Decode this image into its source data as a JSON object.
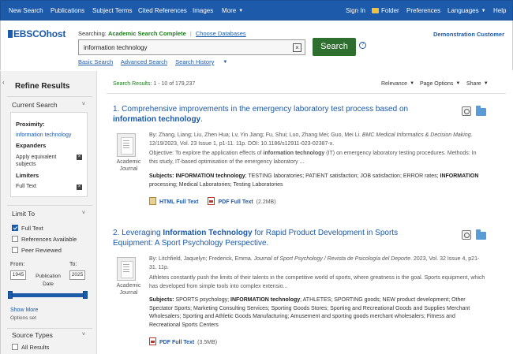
{
  "topnav": {
    "left": [
      "New Search",
      "Publications",
      "Subject Terms",
      "Cited References",
      "Images",
      "More"
    ],
    "right": {
      "signin": "Sign In",
      "folder": "Folder",
      "preferences": "Preferences",
      "languages": "Languages",
      "help": "Help"
    }
  },
  "header": {
    "logo": "EBSCOhost",
    "searching_label": "Searching:",
    "database": "Academic Search Complete",
    "choose_db": "Choose Databases",
    "query": "information technology",
    "search_button": "Search",
    "help_icon": "?",
    "links": [
      "Basic Search",
      "Advanced Search",
      "Search History"
    ],
    "customer": "Demonstration Customer"
  },
  "sidebar": {
    "title": "Refine Results",
    "current_search": "Current Search",
    "proximity_label": "Proximity:",
    "proximity_value": "information technology",
    "expanders_label": "Expanders",
    "expander_value": "Apply equivalent subjects",
    "limiters_label": "Limiters",
    "limiter_value": "Full Text",
    "limit_to": "Limit To",
    "checkboxes": [
      {
        "label": "Full Text",
        "checked": true
      },
      {
        "label": "References Available",
        "checked": false
      },
      {
        "label": "Peer Reviewed",
        "checked": false
      }
    ],
    "from_label": "From:",
    "to_label": "To:",
    "from_value": "1945",
    "to_value": "2025",
    "pub_date_label": "Publication Date",
    "show_more": "Show More",
    "options_set": "Options set",
    "source_types": "Source Types",
    "all_results": "All Results"
  },
  "results": {
    "summary_label": "Search Results:",
    "summary_range": "1 - 10 of 179,237",
    "relevance": "Relevance",
    "page_options": "Page Options",
    "share": "Share",
    "items": [
      {
        "number": "1.",
        "title_pre": "Comprehensive improvements in the emergency laboratory test process based on",
        "title_bold": "information technology",
        "title_post": ".",
        "pub_type": "Academic Journal",
        "authors": "By: Zhang, Liang; Liu, Zhen Hua; Lv, Yin Jiang; Fu, Shui; Luo, Zhang Mei; Guo, Mei Li.",
        "journal": "BMC Medical Informatics & Decision Making",
        "citation": ". 12/19/2023, Vol. 23 Issue 1, p1-11. 11p. DOI: 10.1186/s12911-023-02387-x.",
        "abstract_pre": "Objective: To explore the application effects of",
        "abstract_bold": "information technology",
        "abstract_post": "(IT) on emergency laboratory testing procedures. Methods: In this study, IT-based optimisation of the emergency laboratory ...",
        "subjects_label": "Subjects:",
        "subjects_a": "INFORMATION technology",
        "subjects_b": "; TESTING laboratories; PATIENT satisfaction; JOB satisfaction; ERROR rates;",
        "subjects_c": "INFORMATION",
        "subjects_d": "processing; Medical Laboratories; Testing Laboratories",
        "html_ft": "HTML Full Text",
        "pdf_ft": "PDF Full Text",
        "pdf_size": "(2.2MB)"
      },
      {
        "number": "2.",
        "title_pre": "Leveraging",
        "title_bold": "Information Technology",
        "title_post": "for Rapid Product Development in Sports Equipment: A Sport Psychology Perspective.",
        "pub_type": "Academic Journal",
        "authors": "By: Litchfield, Jaquelyn; Frederick, Emma.",
        "journal": "Journal of Sport Psychology / Revista de Psicología del Deporte",
        "citation": ". 2023, Vol. 32 Issue 4, p21-31. 11p.",
        "abstract": "Athletes constantly push the limits of their talents in the competitive world of sports, where greatness is the goal. Sports equipment, which has developed from simple tools into complex extensio...",
        "subjects_label": "Subjects:",
        "subjects_a": "SPORTS psychology;",
        "subjects_b": "INFORMATION technology",
        "subjects_c": "; ATHLETES; SPORTING goods; NEW product development; Other Spectator Sports; Marketing Consulting Services; Sporting Goods Stores; Sporting and Recreational Goods and Supplies Merchant Wholesalers; Sporting and Athletic Goods Manufacturing; Amusement and sporting goods merchant wholesalers; Fitness and Recreational Sports Centers",
        "pdf_ft": "PDF Full Text",
        "pdf_size": "(3.5MB)"
      }
    ]
  },
  "colors": {
    "nav_bg": "#1d5aaa",
    "search_btn": "#2e6e2e",
    "db_green": "#1f7a1f",
    "link_blue": "#1d5aaa"
  },
  "icons": [
    "folder-icon",
    "clear-icon",
    "help-icon",
    "collapse-icon",
    "chevron-down-icon",
    "remove-icon",
    "journal-icon",
    "html-icon",
    "pdf-icon",
    "preview-icon",
    "add-to-folder-icon"
  ]
}
